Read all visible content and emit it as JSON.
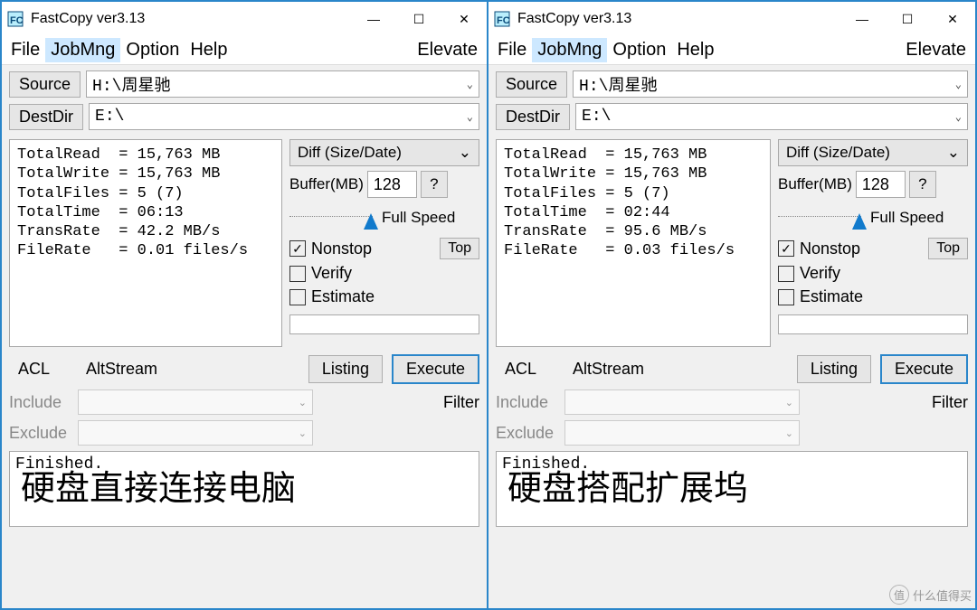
{
  "app": {
    "title": "FastCopy ver3.13"
  },
  "menu": {
    "file": "File",
    "jobmng": "JobMng",
    "option": "Option",
    "help": "Help",
    "elevate": "Elevate"
  },
  "labels": {
    "source": "Source",
    "destdir": "DestDir",
    "mode": "Diff (Size/Date)",
    "buffer": "Buffer(MB)",
    "buffer_val": "128",
    "q": "?",
    "speed": "Full Speed",
    "nonstop": "Nonstop",
    "verify": "Verify",
    "estimate": "Estimate",
    "top": "Top",
    "acl": "ACL",
    "altstream": "AltStream",
    "listing": "Listing",
    "execute": "Execute",
    "include": "Include",
    "exclude": "Exclude",
    "filter": "Filter",
    "finished": "Finished."
  },
  "paths": {
    "source": "H:\\周星驰",
    "dest": "E:\\"
  },
  "left": {
    "stats": "TotalRead  = 15,763 MB\nTotalWrite = 15,763 MB\nTotalFiles = 5 (7)\nTotalTime  = 06:13\nTransRate  = 42.2 MB/s\nFileRate   = 0.01 files/s",
    "caption": "硬盘直接连接电脑"
  },
  "right": {
    "stats": "TotalRead  = 15,763 MB\nTotalWrite = 15,763 MB\nTotalFiles = 5 (7)\nTotalTime  = 02:44\nTransRate  = 95.6 MB/s\nFileRate   = 0.03 files/s",
    "caption": "硬盘搭配扩展坞"
  },
  "watermark": "什么值得买"
}
